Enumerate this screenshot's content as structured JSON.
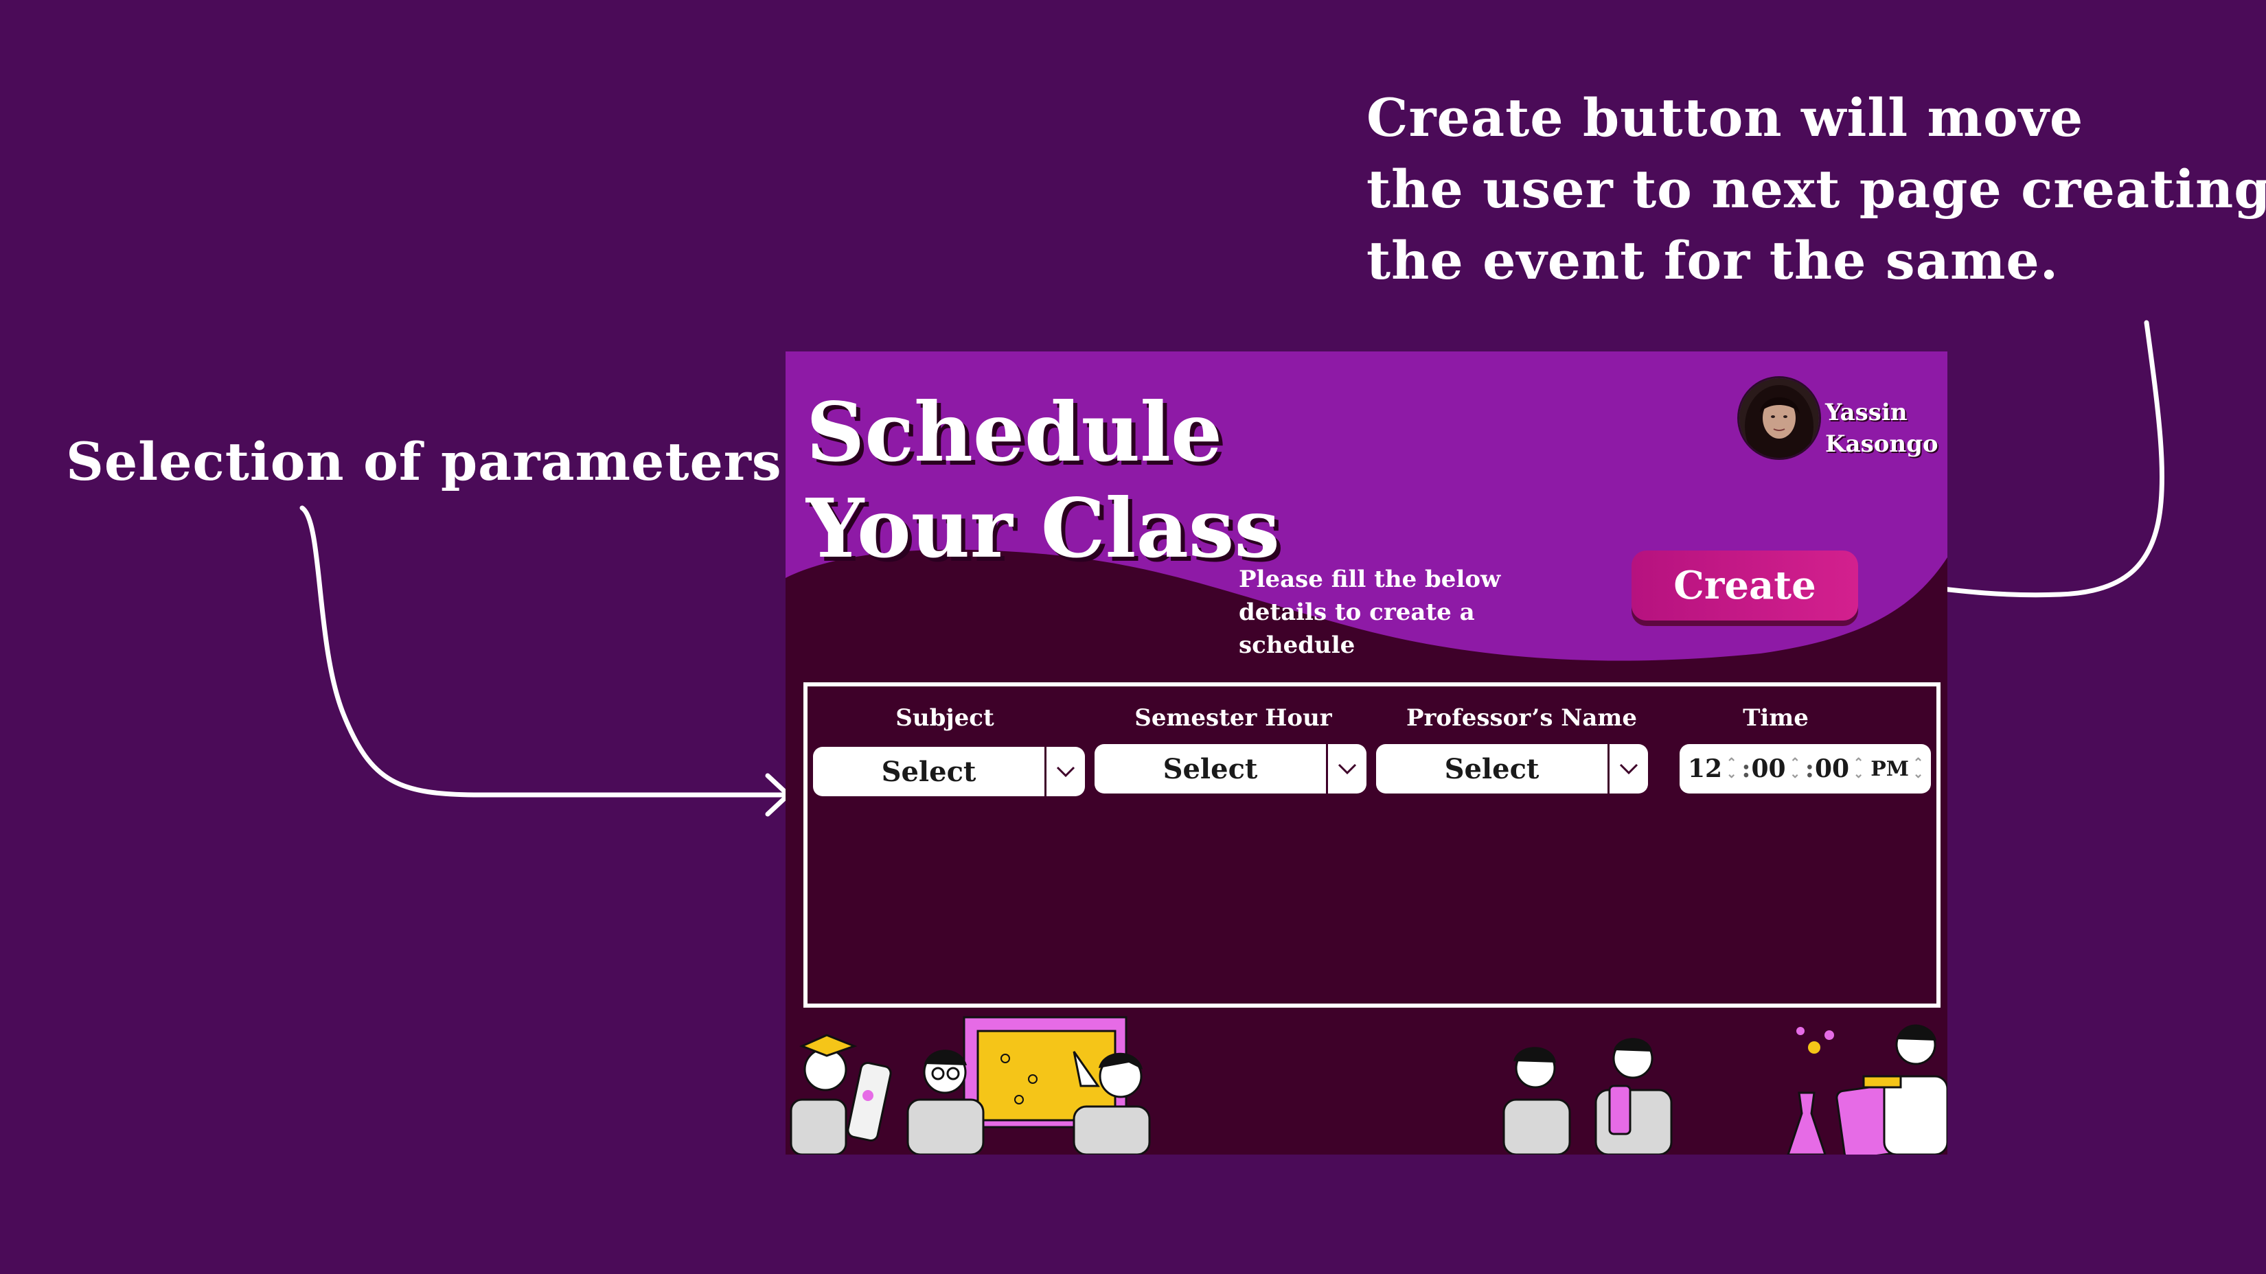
{
  "annotations": {
    "create_note_lines": [
      "Create button will move",
      "the user to next page creating",
      "the event for the same."
    ],
    "selection_note": "Selection of parameters"
  },
  "header": {
    "title": "Schedule Your Class",
    "user_name": "Yassin Kasongo",
    "helper_text": "Please fill the below details to create a schedule",
    "create_label": "Create"
  },
  "form": {
    "fields": [
      {
        "label": "Subject",
        "value": "Select"
      },
      {
        "label": "Semester Hour",
        "value": "Select"
      },
      {
        "label": "Professor’s Name",
        "value": "Select"
      },
      {
        "label": "Time"
      }
    ],
    "time": {
      "hour": "12",
      "minute": "00",
      "second": "00",
      "period": "PM"
    }
  },
  "colors": {
    "background": "#4b0b58",
    "header_purple": "#8e1aa6",
    "panel_dark": "#3e0129",
    "create_button": "#c8168a",
    "illustration_accent": "#f5c518",
    "illustration_pink": "#e66be6"
  },
  "icons": [
    "chevron-down-icon",
    "arrow-icon",
    "avatar-photo"
  ]
}
